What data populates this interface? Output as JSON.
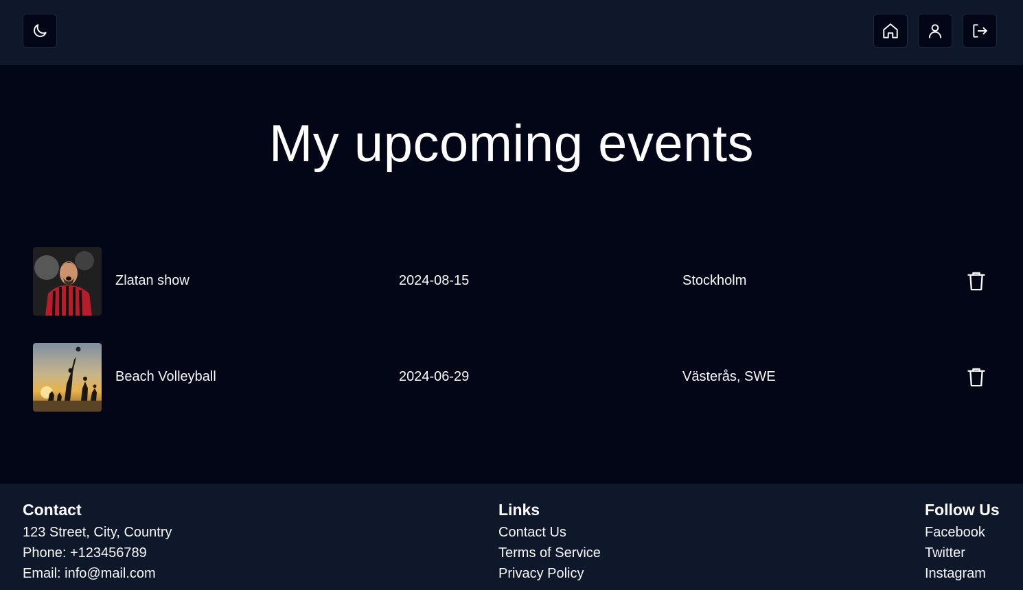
{
  "header": {
    "theme_icon": "moon-icon",
    "nav_icons": [
      "home-icon",
      "user-icon",
      "logout-icon"
    ]
  },
  "main": {
    "title": "My upcoming events",
    "events": [
      {
        "name": "Zlatan show",
        "date": "2024-08-15",
        "location": "Stockholm",
        "image": "football-player-photo"
      },
      {
        "name": "Beach Volleyball",
        "date": "2024-06-29",
        "location": "Västerås, SWE",
        "image": "beach-volleyball-sunset-photo"
      }
    ],
    "delete_icon": "trash-icon"
  },
  "footer": {
    "contact": {
      "heading": "Contact",
      "address": "123 Street, City, Country",
      "phone": "Phone: +123456789",
      "email": "Email: info@mail.com"
    },
    "links": {
      "heading": "Links",
      "items": [
        "Contact Us",
        "Terms of Service",
        "Privacy Policy"
      ]
    },
    "follow": {
      "heading": "Follow Us",
      "items": [
        "Facebook",
        "Twitter",
        "Instagram"
      ]
    }
  },
  "colors": {
    "page_bg": "#020617",
    "bar_bg": "#0f172a",
    "text": "#f8fafc"
  }
}
